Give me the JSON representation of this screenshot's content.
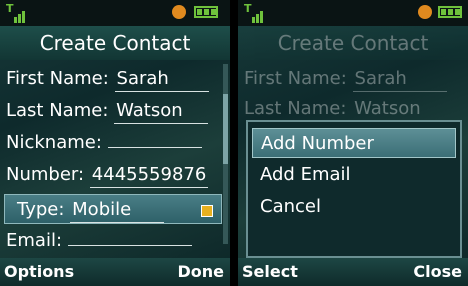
{
  "left": {
    "title": "Create Contact",
    "fields": [
      {
        "label": "First Name:",
        "value": "Sarah"
      },
      {
        "label": "Last Name:",
        "value": "Watson"
      },
      {
        "label": "Nickname:",
        "value": ""
      },
      {
        "label": "Number:",
        "value": "4445559876"
      },
      {
        "label": "Type:",
        "value": "Mobile"
      },
      {
        "label": "Email:",
        "value": ""
      }
    ],
    "softkeys": {
      "left": "Options",
      "right": "Done"
    }
  },
  "right": {
    "title": "Create Contact",
    "fields": [
      {
        "label": "First Name:",
        "value": "Sarah"
      },
      {
        "label": "Last Name:",
        "value": "Watson"
      }
    ],
    "menu": [
      "Add Number",
      "Add Email",
      "Cancel"
    ],
    "selected_index": 0,
    "softkeys": {
      "left": "Select",
      "right": "Close"
    }
  },
  "colors": {
    "accent": "#6fc23c",
    "bluetooth": "#e08a1f",
    "highlight": "#4a7e86"
  },
  "icons": [
    "signal-icon",
    "bluetooth-icon",
    "battery-icon"
  ]
}
